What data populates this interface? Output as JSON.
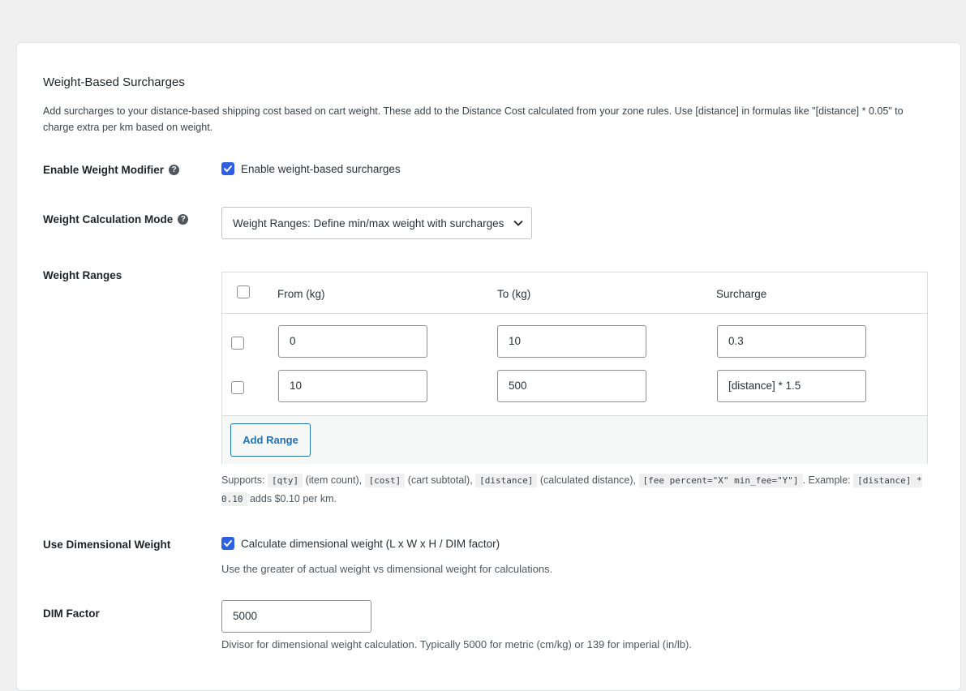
{
  "section": {
    "title": "Weight-Based Surcharges",
    "description": "Add surcharges to your distance-based shipping cost based on cart weight. These add to the Distance Cost calculated from your zone rules. Use [distance] in formulas like \"[distance] * 0.05\" to charge extra per km based on weight."
  },
  "enable_modifier": {
    "label": "Enable Weight Modifier",
    "help_icon": "question-icon",
    "checkbox_label": "Enable weight-based surcharges",
    "checked": true
  },
  "calc_mode": {
    "label": "Weight Calculation Mode",
    "help_icon": "question-icon",
    "selected": "Weight Ranges: Define min/max weight with surcharges"
  },
  "weight_ranges": {
    "label": "Weight Ranges",
    "columns": [
      "From (kg)",
      "To (kg)",
      "Surcharge"
    ],
    "rows": [
      {
        "from": "0",
        "to": "10",
        "surcharge": "0.3"
      },
      {
        "from": "10",
        "to": "500",
        "surcharge": "[distance] * 1.5"
      }
    ],
    "add_button": "Add Range",
    "supports": {
      "prefix": "Supports:",
      "qty_code": "[qty]",
      "qty_text": "(item count),",
      "cost_code": "[cost]",
      "cost_text": "(cart subtotal),",
      "distance_code": "[distance]",
      "distance_text": "(calculated distance),",
      "fee_code": "[fee percent=\"X\" min_fee=\"Y\"]",
      "example_prefix": ". Example:",
      "example_code": "[distance] * 0.10",
      "example_text": "adds $0.10 per km."
    }
  },
  "dimensional": {
    "label": "Use Dimensional Weight",
    "checkbox_label": "Calculate dimensional weight (L x W x H / DIM factor)",
    "checked": true,
    "help": "Use the greater of actual weight vs dimensional weight for calculations."
  },
  "dim_factor": {
    "label": "DIM Factor",
    "value": "5000",
    "help": "Divisor for dimensional weight calculation. Typically 5000 for metric (cm/kg) or 139 for imperial (in/lb)."
  },
  "colors": {
    "accent": "#2f5ee0",
    "link": "#2271b1"
  }
}
